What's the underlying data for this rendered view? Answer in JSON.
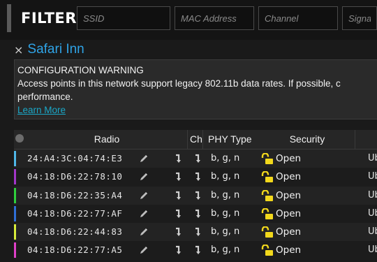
{
  "filters": {
    "label": "FILTERS:",
    "ssid_placeholder": "SSID",
    "mac_placeholder": "MAC Address",
    "channel_placeholder": "Channel",
    "signal_placeholder": "Signal"
  },
  "network": {
    "close_glyph": "×",
    "title": "Safari Inn"
  },
  "warning": {
    "heading": "CONFIGURATION WARNING",
    "line1": "Access points in this network support legacy 802.11b data rates. If possible, c",
    "line2": "performance.",
    "link": "Learn More"
  },
  "table": {
    "headers": {
      "radio": "Radio",
      "channel": "Ch",
      "phy": "PHY Type",
      "security": "Security"
    },
    "rows": [
      {
        "mac": "24:A4:3C:04:74:E3",
        "phy": "b, g, n",
        "security": "Open",
        "extra": "Ub",
        "color": "#4fb7e8"
      },
      {
        "mac": "04:18:D6:22:78:10",
        "phy": "b, g, n",
        "security": "Open",
        "extra": "Ub",
        "color": "#a236c9"
      },
      {
        "mac": "04:18:D6:22:35:A4",
        "phy": "b, g, n",
        "security": "Open",
        "extra": "Ub",
        "color": "#2fcf3c"
      },
      {
        "mac": "04:18:D6:22:77:AF",
        "phy": "b, g, n",
        "security": "Open",
        "extra": "Ub",
        "color": "#2f6fd6"
      },
      {
        "mac": "04:18:D6:22:44:83",
        "phy": "b, g, n",
        "security": "Open",
        "extra": "Ub",
        "color": "#d8ec3a"
      },
      {
        "mac": "04:18:D6:22:77:A5",
        "phy": "b, g, n",
        "security": "Open",
        "extra": "Ub",
        "color": "#e040c8"
      }
    ]
  },
  "icons": {
    "pencil": "pencil-icon",
    "arrow": "turn-arrow-icon",
    "lock": "unlock-icon"
  },
  "colors": {
    "accent": "#2fa3e6",
    "link": "#1aa8c8",
    "lock": "#f2d81c"
  }
}
